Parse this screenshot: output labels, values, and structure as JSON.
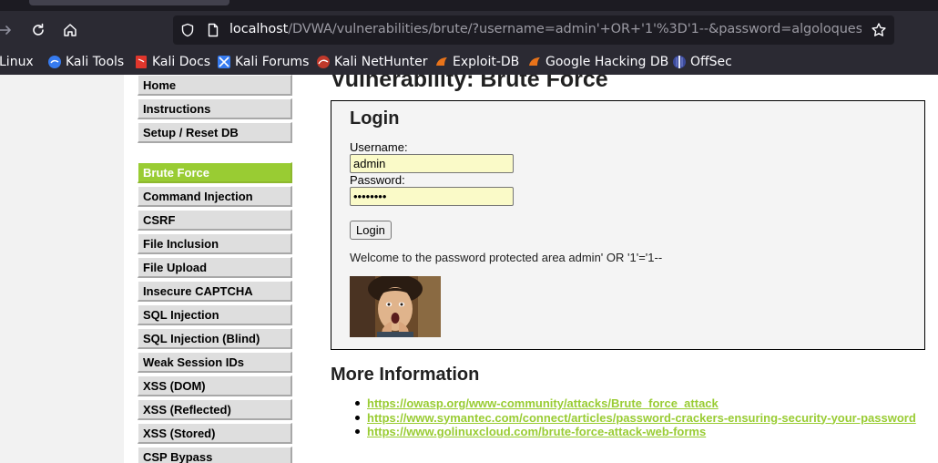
{
  "browser": {
    "url_host": "localhost",
    "url_path": "/DVWA/vulnerabilities/brute/?username=admin'+OR+'1'%3D'1--&password=algoloquesea&Login=Login#",
    "bookmarks": [
      {
        "label": "Linux",
        "icon": "kali-icon"
      },
      {
        "label": "Kali Tools",
        "icon": "kali-tools-icon"
      },
      {
        "label": "Kali Docs",
        "icon": "kali-docs-icon"
      },
      {
        "label": "Kali Forums",
        "icon": "kali-forums-icon"
      },
      {
        "label": "Kali NetHunter",
        "icon": "nethunter-icon"
      },
      {
        "label": "Exploit-DB",
        "icon": "exploit-db-icon"
      },
      {
        "label": "Google Hacking DB",
        "icon": "ghdb-icon"
      },
      {
        "label": "OffSec",
        "icon": "offsec-icon"
      }
    ]
  },
  "menu": {
    "group1": [
      "Home",
      "Instructions",
      "Setup / Reset DB"
    ],
    "group2": [
      "Brute Force",
      "Command Injection",
      "CSRF",
      "File Inclusion",
      "File Upload",
      "Insecure CAPTCHA",
      "SQL Injection",
      "SQL Injection (Blind)",
      "Weak Session IDs",
      "XSS (DOM)",
      "XSS (Reflected)",
      "XSS (Stored)",
      "CSP Bypass"
    ],
    "selected": "Brute Force"
  },
  "page": {
    "title": "Vulnerability: Brute Force",
    "login": {
      "heading": "Login",
      "username_label": "Username:",
      "username_value": "admin",
      "password_label": "Password:",
      "password_value": "••••••••",
      "button_label": "Login"
    },
    "welcome_message": "Welcome to the password protected area admin' OR '1'='1--",
    "more_info": {
      "heading": "More Information",
      "links": [
        "https://owasp.org/www-community/attacks/Brute_force_attack",
        "https://www.symantec.com/connect/articles/password-crackers-ensuring-security-your-password",
        "https://www.golinuxcloud.com/brute-force-attack-web-forms"
      ]
    }
  },
  "colors": {
    "accent": "#99cc33",
    "input_bg": "#fafac8"
  }
}
